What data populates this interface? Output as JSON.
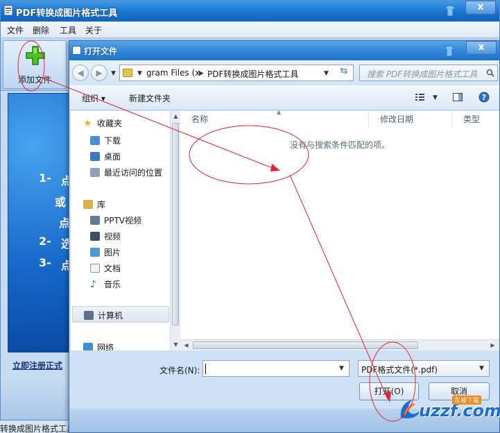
{
  "main_window": {
    "title": "PDF转换成图片格式工具",
    "close_label": "x",
    "menu": [
      "文件",
      "删除",
      "工具",
      "关于"
    ],
    "add_file_label": "添加文件",
    "instructions": [
      {
        "num": "1-",
        "text": "点"
      },
      {
        "num": "",
        "text": "或"
      },
      {
        "num": "",
        "text": "点"
      },
      {
        "num": "2-",
        "text": "选"
      },
      {
        "num": "3-",
        "text": "点"
      }
    ],
    "register_link": "立即注册正式",
    "statusbar": "转换成图片格式工具."
  },
  "dialog": {
    "title": "打开文件",
    "close_label": "x",
    "address_segments": [
      "gram Files (x",
      "PDF转换成图片格式工具"
    ],
    "search_placeholder": "搜索 PDF转换成图片格式工具",
    "commands": {
      "organize": "组织 ▾",
      "new_folder": "新建文件夹"
    },
    "nav": {
      "favorites_header": "收藏夹",
      "favorites": [
        "下载",
        "桌面",
        "最近访问的位置"
      ],
      "libraries_header": "库",
      "libraries": [
        "PPTV视频",
        "视频",
        "图片",
        "文档",
        "音乐"
      ],
      "computer": "计算机",
      "network": "网络"
    },
    "columns": [
      "名称",
      "修改日期",
      "类型"
    ],
    "empty_message": "没有与搜索条件匹配的项。",
    "filename_label": "文件名(N):",
    "filename_value": "",
    "file_type": "PDF格式文件(*.pdf)",
    "open_button": "打开(O)",
    "cancel_button": "取消"
  },
  "watermark": {
    "text": "uzzf.com",
    "tag": "东坡下载"
  },
  "colors": {
    "annotation": "#e8202a",
    "title_blue": "#1a73cf",
    "accent": "#3b7bd0"
  }
}
